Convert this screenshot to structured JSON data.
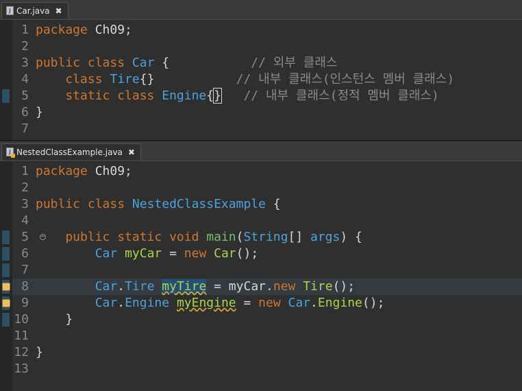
{
  "editor1": {
    "tab_label": "Car.java",
    "close_glyph": "✖",
    "lines": [
      {
        "n": "1",
        "tokens": [
          {
            "t": "package ",
            "c": "kw"
          },
          {
            "t": "Ch09;",
            "c": ""
          }
        ]
      },
      {
        "n": "2",
        "tokens": []
      },
      {
        "n": "3",
        "tokens": [
          {
            "t": "public class ",
            "c": "kw"
          },
          {
            "t": "Car",
            "c": "cls"
          },
          {
            "t": " {           ",
            "c": ""
          },
          {
            "t": "// 외부 클래스",
            "c": "cm"
          }
        ]
      },
      {
        "n": "4",
        "tokens": [
          {
            "t": "    class ",
            "c": "kw"
          },
          {
            "t": "Tire",
            "c": "cls"
          },
          {
            "t": "{}           ",
            "c": ""
          },
          {
            "t": "// 내부 클래스(인스턴스 멤버 클래스)",
            "c": "cm"
          }
        ]
      },
      {
        "n": "5",
        "tokens": [
          {
            "t": "    static class ",
            "c": "kw"
          },
          {
            "t": "Engine",
            "c": "cls"
          },
          {
            "t": "{",
            "c": ""
          },
          {
            "t": "}",
            "c": "caret"
          },
          {
            "t": "   ",
            "c": ""
          },
          {
            "t": "// 내부 클래스(정적 멤버 클래스)",
            "c": "cm"
          }
        ]
      },
      {
        "n": "6",
        "tokens": [
          {
            "t": "}",
            "c": ""
          }
        ]
      },
      {
        "n": "7",
        "tokens": []
      }
    ]
  },
  "editor2": {
    "tab_label": "NestedClassExample.java",
    "close_glyph": "✖",
    "lines": [
      {
        "n": "1",
        "tokens": [
          {
            "t": "package ",
            "c": "kw"
          },
          {
            "t": "Ch09;",
            "c": ""
          }
        ]
      },
      {
        "n": "2",
        "tokens": []
      },
      {
        "n": "3",
        "tokens": [
          {
            "t": "public class ",
            "c": "kw"
          },
          {
            "t": "NestedClassExample",
            "c": "cls"
          },
          {
            "t": " {",
            "c": ""
          }
        ]
      },
      {
        "n": "4",
        "tokens": []
      },
      {
        "n": "5",
        "tokens": [
          {
            "t": "    public static void ",
            "c": "kw"
          },
          {
            "t": "main",
            "c": "fn"
          },
          {
            "t": "(",
            "c": ""
          },
          {
            "t": "String",
            "c": "cls"
          },
          {
            "t": "[] ",
            "c": ""
          },
          {
            "t": "args",
            "c": "cls"
          },
          {
            "t": ") {",
            "c": ""
          }
        ]
      },
      {
        "n": "6",
        "tokens": [
          {
            "t": "        ",
            "c": ""
          },
          {
            "t": "Car",
            "c": "cls"
          },
          {
            "t": " ",
            "c": ""
          },
          {
            "t": "myCar",
            "c": "var"
          },
          {
            "t": " = ",
            "c": ""
          },
          {
            "t": "new ",
            "c": "kw"
          },
          {
            "t": "Car",
            "c": "tire"
          },
          {
            "t": "();",
            "c": ""
          }
        ]
      },
      {
        "n": "7",
        "tokens": []
      },
      {
        "n": "8",
        "tokens": [
          {
            "t": "        ",
            "c": ""
          },
          {
            "t": "Car",
            "c": "cls"
          },
          {
            "t": ".",
            "c": ""
          },
          {
            "t": "Tire",
            "c": "cls"
          },
          {
            "t": " ",
            "c": ""
          },
          {
            "t": "myTire",
            "c": "var sel squig"
          },
          {
            "t": " = myCar.",
            "c": ""
          },
          {
            "t": "new ",
            "c": "kw"
          },
          {
            "t": "Tire",
            "c": "tire"
          },
          {
            "t": "();",
            "c": ""
          }
        ]
      },
      {
        "n": "9",
        "tokens": [
          {
            "t": "        ",
            "c": ""
          },
          {
            "t": "Car",
            "c": "cls"
          },
          {
            "t": ".",
            "c": ""
          },
          {
            "t": "Engine",
            "c": "cls"
          },
          {
            "t": " ",
            "c": ""
          },
          {
            "t": "myEngine",
            "c": "var squig"
          },
          {
            "t": " = ",
            "c": ""
          },
          {
            "t": "new ",
            "c": "kw"
          },
          {
            "t": "Car",
            "c": "cls"
          },
          {
            "t": ".",
            "c": ""
          },
          {
            "t": "Engine",
            "c": "tire"
          },
          {
            "t": "();",
            "c": ""
          }
        ]
      },
      {
        "n": "10",
        "tokens": [
          {
            "t": "    }",
            "c": ""
          }
        ]
      },
      {
        "n": "11",
        "tokens": []
      },
      {
        "n": "12",
        "tokens": [
          {
            "t": "}",
            "c": ""
          }
        ]
      },
      {
        "n": "13",
        "tokens": []
      }
    ]
  },
  "colors": {
    "keyword": "#cc7832",
    "class": "#4aa3df",
    "method": "#6fc16f",
    "comment": "#8a8a8a",
    "variable": "#a9d64a"
  },
  "icons": {
    "file": "java-file-icon",
    "close": "close-icon",
    "fold": "fold-toggle-icon",
    "warning": "warning-marker-icon"
  }
}
